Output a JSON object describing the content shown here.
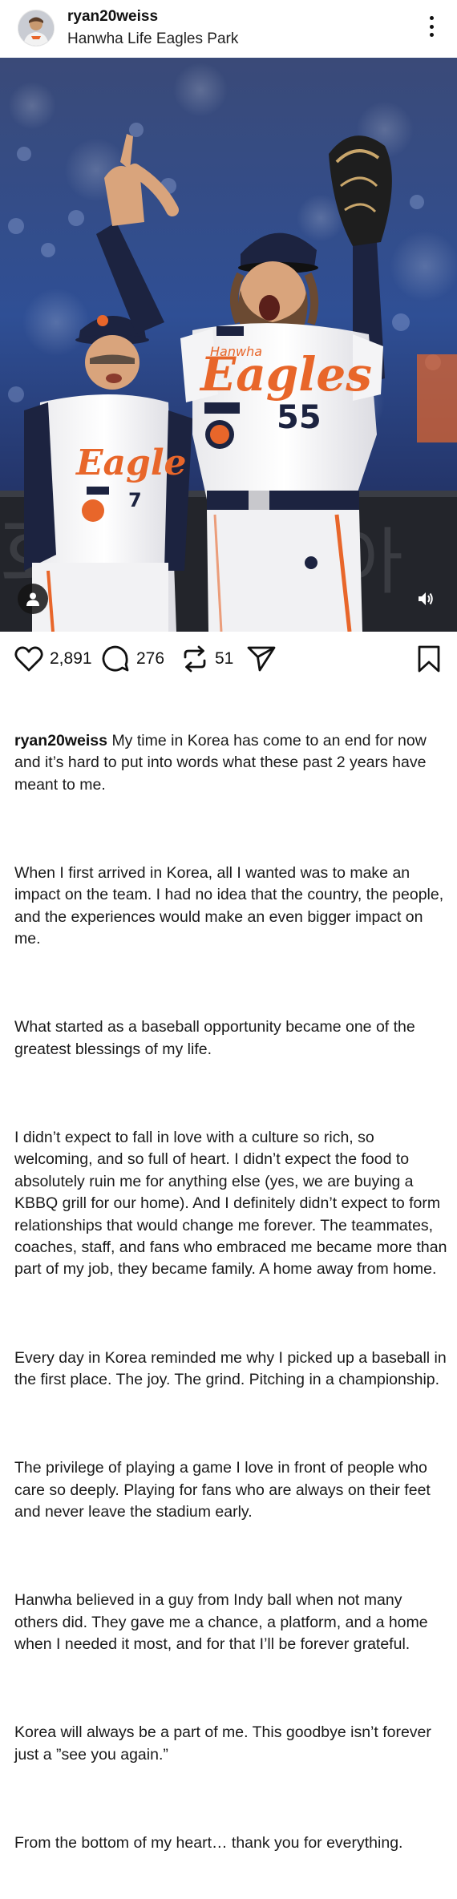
{
  "header": {
    "username": "ryan20weiss",
    "location": "Hanwha Life Eagles Park",
    "avatar_icon": "profile-photo",
    "more_icon": "vertical-ellipsis-icon"
  },
  "media": {
    "tag_icon": "person-icon",
    "volume_icon": "speaker-icon",
    "jersey": {
      "main_team": "Eagles",
      "main_number": "55",
      "sponsor": "Hanwha",
      "second_team": "Eagles",
      "second_number": "7"
    }
  },
  "actions": {
    "likes": "2,891",
    "comments": "276",
    "reposts": "51",
    "like_icon": "heart-icon",
    "comment_icon": "speech-bubble-icon",
    "repost_icon": "repost-icon",
    "share_icon": "paper-plane-icon",
    "save_icon": "bookmark-icon"
  },
  "caption": {
    "username": "ryan20weiss",
    "paragraphs": [
      "My time in Korea has come to an end for now and it’s hard to put into words what these past 2 years have meant to me.",
      "When I first arrived in Korea, all I wanted was to make an impact on the team. I had no idea that the country, the people, and the experiences would make an even bigger impact on me.",
      "What started as a baseball opportunity became one of the greatest blessings of my life.",
      "I didn’t expect to fall in love with a culture so rich, so welcoming, and so full of heart. I didn’t expect the food to absolutely ruin me for anything else (yes, we are buying a KBBQ grill for our home). And I definitely didn’t expect to form relationships that would change me forever. The teammates, coaches, staff, and fans who embraced me became more than part of my job, they became family. A home away from home.",
      "Every day in Korea reminded me why I picked up a baseball in the first place. The joy. The grind. Pitching in a championship.",
      "The privilege of playing a game I love in front of people who care so deeply. Playing for fans who are always on their feet and never leave the stadium early.",
      "Hanwha believed in a guy from Indy ball when not many others did. They gave me a chance, a platform, and a home when I needed it most, and for that I’ll be forever grateful.",
      "Korea will always be a part of me. This goodbye isn’t forever just a ”see you again.”",
      "From the bottom of my heart… thank you for everything."
    ]
  },
  "colors": {
    "jersey_orange": "#e8662a",
    "navy": "#1c2340",
    "text": "#111111"
  }
}
